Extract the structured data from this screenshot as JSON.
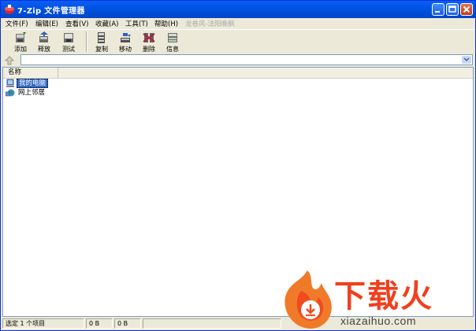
{
  "window": {
    "title": "7-Zip 文件管理器"
  },
  "menu": {
    "items": [
      "文件(F)",
      "编辑(E)",
      "查看(V)",
      "收藏(A)",
      "工具(T)",
      "帮助(H)"
    ],
    "disabled_item": "龙卷风-法阳晚枫"
  },
  "toolbar": {
    "buttons": [
      {
        "label": "添加",
        "icon": "add-icon"
      },
      {
        "label": "释放",
        "icon": "extract-icon"
      },
      {
        "label": "测试",
        "icon": "test-icon"
      },
      {
        "label": "复制",
        "icon": "copy-icon"
      },
      {
        "label": "移动",
        "icon": "move-icon"
      },
      {
        "label": "删除",
        "icon": "delete-icon"
      },
      {
        "label": "信息",
        "icon": "info-icon"
      }
    ]
  },
  "address": {
    "value": ""
  },
  "list": {
    "column_name": "名称",
    "rows": [
      {
        "label": "我的电脑",
        "icon": "computer-icon",
        "selected": true
      },
      {
        "label": "网上邻居",
        "icon": "network-icon",
        "selected": false
      }
    ]
  },
  "status": {
    "selected_text": "选定 1 个项目",
    "size1": "0 B",
    "size2": "0 B"
  },
  "watermark": {
    "brand": "下载火",
    "url": "xiazaihuo.com"
  },
  "colors": {
    "titlebar": "#0054E3",
    "selection": "#316AC5",
    "watermark": "#F0401E"
  }
}
